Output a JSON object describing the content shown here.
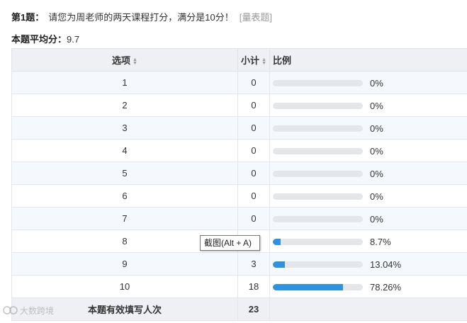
{
  "question": {
    "number": "第1题：",
    "text": "请您为周老师的两天课程打分，满分是10分！",
    "chart_link": "[量表题]"
  },
  "average": {
    "label": "本题平均分：",
    "value": "9.7"
  },
  "table": {
    "headers": {
      "option": "选项",
      "count": "小计",
      "ratio": "比例"
    },
    "rows": [
      {
        "option": "1",
        "count": "0",
        "percent": "0%",
        "ratio": 0
      },
      {
        "option": "2",
        "count": "0",
        "percent": "0%",
        "ratio": 0
      },
      {
        "option": "3",
        "count": "0",
        "percent": "0%",
        "ratio": 0
      },
      {
        "option": "4",
        "count": "0",
        "percent": "0%",
        "ratio": 0
      },
      {
        "option": "5",
        "count": "0",
        "percent": "0%",
        "ratio": 0
      },
      {
        "option": "6",
        "count": "0",
        "percent": "0%",
        "ratio": 0
      },
      {
        "option": "7",
        "count": "0",
        "percent": "0%",
        "ratio": 0
      },
      {
        "option": "8",
        "count": "",
        "percent": "8.7%",
        "ratio": 0.087
      },
      {
        "option": "9",
        "count": "3",
        "percent": "13.04%",
        "ratio": 0.1304
      },
      {
        "option": "10",
        "count": "18",
        "percent": "78.26%",
        "ratio": 0.7826
      }
    ],
    "total": {
      "label": "本题有效填写人次",
      "value": "23"
    }
  },
  "tooltip": {
    "text": "截图(Alt + A)"
  },
  "watermark": {
    "text": "大数跨境"
  },
  "colors": {
    "bar_fill": "#2b92e4",
    "bar_track": "#e4e6ea"
  },
  "icons": {
    "sort": "sort-arrows-icon",
    "watermark": "camera-logo-icon"
  }
}
